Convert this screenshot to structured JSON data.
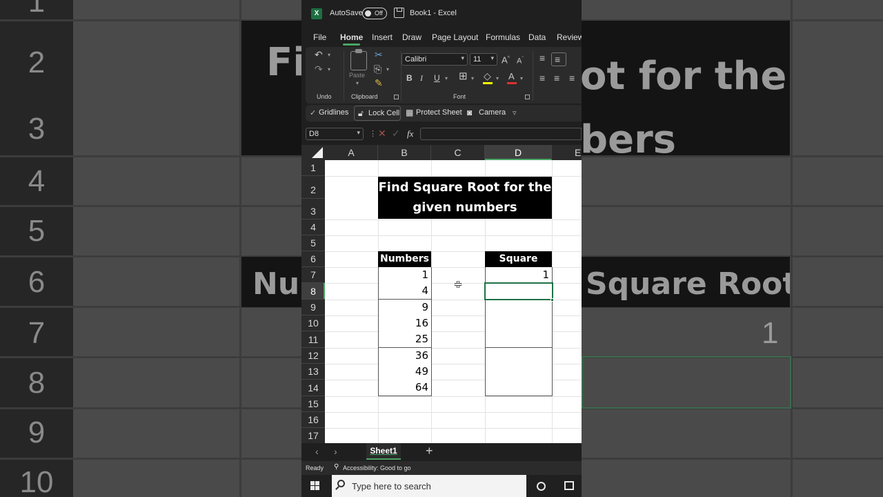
{
  "background": {
    "row_numbers": [
      "1",
      "2",
      "3",
      "4",
      "5",
      "6",
      "7",
      "8",
      "9",
      "10"
    ],
    "title_text_line1": "Find Square Root for the",
    "title_text_line2": "given numbers",
    "header_left": "Numbers",
    "header_right": "Square Root",
    "value": "1"
  },
  "titlebar": {
    "app_icon": "excel-logo-icon",
    "autosave_label": "AutoSave",
    "autosave_state": "Off",
    "document_title": "Book1  -  Excel"
  },
  "tabs": [
    {
      "label": "File"
    },
    {
      "label": "Home"
    },
    {
      "label": "Insert"
    },
    {
      "label": "Draw"
    },
    {
      "label": "Page Layout"
    },
    {
      "label": "Formulas"
    },
    {
      "label": "Data"
    },
    {
      "label": "Review"
    }
  ],
  "ribbon": {
    "undo_group": "Undo",
    "clipboard_group": "Clipboard",
    "paste_label": "Paste",
    "font_group": "Font",
    "font_name": "Calibri",
    "font_size": "11",
    "bold": "B",
    "italic": "I",
    "underline": "U"
  },
  "quick_access": {
    "gridlines": "Gridlines",
    "lock_cell": "Lock Cell",
    "protect_sheet": "Protect Sheet",
    "camera": "Camera"
  },
  "formula_bar": {
    "name_box": "D8",
    "fx": "fx",
    "content": ""
  },
  "grid": {
    "columns": [
      "A",
      "B",
      "C",
      "D",
      "E"
    ],
    "selected_column": "D",
    "rows": [
      "1",
      "2",
      "3",
      "4",
      "5",
      "6",
      "7",
      "8",
      "9",
      "10",
      "11",
      "12",
      "13",
      "14",
      "15",
      "16",
      "17"
    ],
    "selected_row": "8",
    "title_line1": "Find Square Root for the",
    "title_line2": "given numbers",
    "numbers_header": "Numbers",
    "square_root_header": "Square Root",
    "numbers": [
      "1",
      "4",
      "9",
      "16",
      "25",
      "36",
      "49",
      "64"
    ],
    "square_roots": [
      "1",
      "",
      "",
      "",
      "",
      "",
      "",
      ""
    ]
  },
  "sheets": {
    "active": "Sheet1",
    "add_label": "+"
  },
  "status": {
    "ready": "Ready",
    "accessibility": "Accessibility: Good to go"
  },
  "taskbar": {
    "search_placeholder": "Type here to search"
  }
}
